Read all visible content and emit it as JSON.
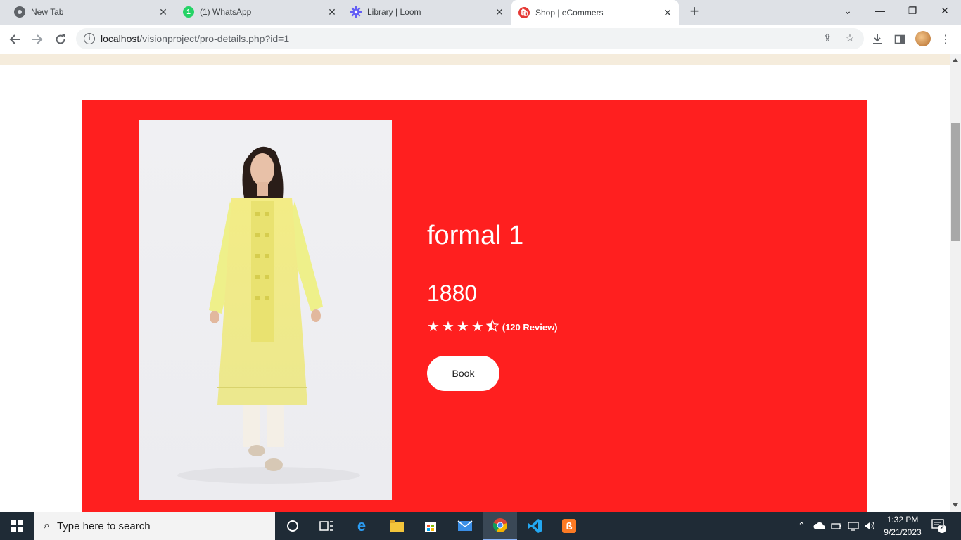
{
  "browser": {
    "tabs": [
      {
        "title": "New Tab",
        "icon": "chrome-icon",
        "active": false
      },
      {
        "title": "(1) WhatsApp",
        "icon": "whatsapp-icon",
        "badge": "1",
        "active": false
      },
      {
        "title": "Library | Loom",
        "icon": "loom-icon",
        "active": false
      },
      {
        "title": "Shop | eCommers",
        "icon": "shop-icon",
        "active": true
      }
    ],
    "address": {
      "host": "localhost",
      "path": "/visionproject/pro-details.php?id=1"
    }
  },
  "product": {
    "name": "formal 1",
    "price": "1880",
    "rating": 4.5,
    "reviews_label": "(120 Review)",
    "book_label": "Book"
  },
  "taskbar": {
    "search_placeholder": "Type here to search",
    "time": "1:32 PM",
    "date": "9/21/2023",
    "notification_count": "2"
  },
  "colors": {
    "panel": "#ff1f1f",
    "stripe": "#f5ecdc",
    "tabstrip": "#dee1e6",
    "taskbar": "#1f2b36"
  }
}
